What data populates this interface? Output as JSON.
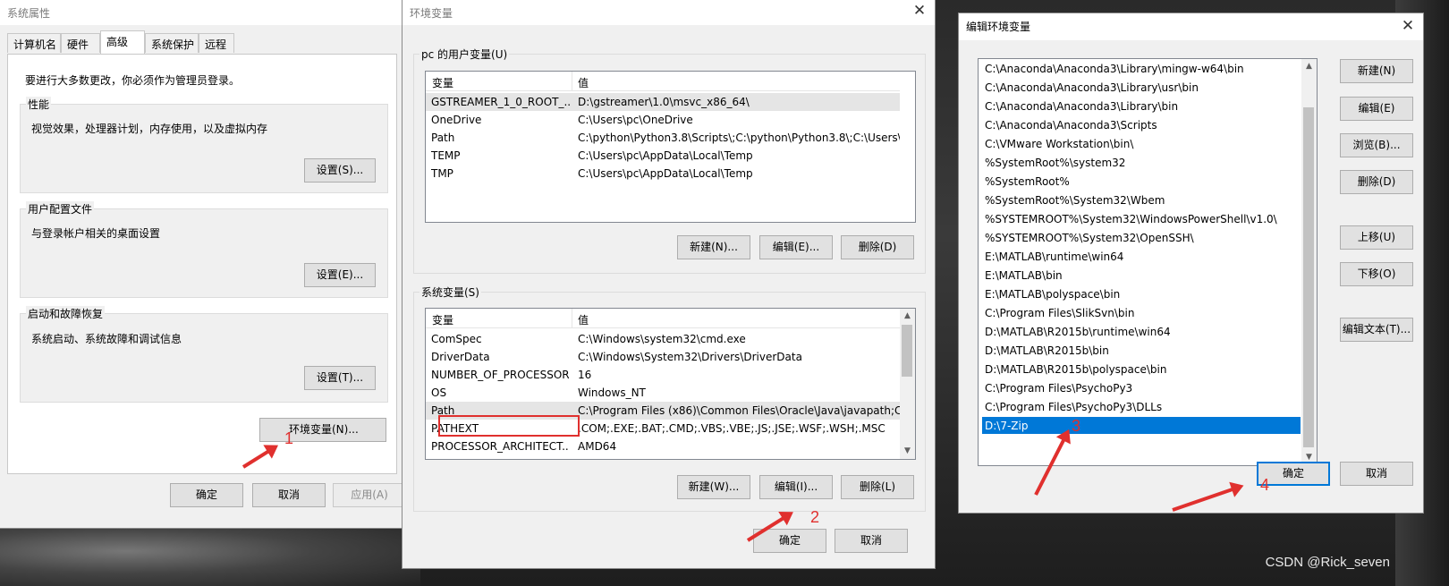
{
  "sysprops": {
    "title": "系统属性",
    "tabs": [
      "计算机名",
      "硬件",
      "高级",
      "系统保护",
      "远程"
    ],
    "notice": "要进行大多数更改，你必须作为管理员登录。",
    "perf_label": "性能",
    "perf_desc": "视觉效果，处理器计划，内存使用，以及虚拟内存",
    "perf_btn": "设置(S)...",
    "profile_label": "用户配置文件",
    "profile_desc": "与登录帐户相关的桌面设置",
    "profile_btn": "设置(E)...",
    "startup_label": "启动和故障恢复",
    "startup_desc": "系统启动、系统故障和调试信息",
    "startup_btn": "设置(T)...",
    "envvar_btn": "环境变量(N)...",
    "ok": "确定",
    "cancel": "取消",
    "apply": "应用(A)"
  },
  "envvars": {
    "title": "环境变量",
    "user_group": "pc 的用户变量(U)",
    "col_var": "变量",
    "col_val": "值",
    "user_rows": [
      {
        "name": "GSTREAMER_1_0_ROOT_...",
        "value": "D:\\gstreamer\\1.0\\msvc_x86_64\\"
      },
      {
        "name": "OneDrive",
        "value": "C:\\Users\\pc\\OneDrive"
      },
      {
        "name": "Path",
        "value": "C:\\python\\Python3.8\\Scripts\\;C:\\python\\Python3.8\\;C:\\Users\\p..."
      },
      {
        "name": "TEMP",
        "value": "C:\\Users\\pc\\AppData\\Local\\Temp"
      },
      {
        "name": "TMP",
        "value": "C:\\Users\\pc\\AppData\\Local\\Temp"
      }
    ],
    "user_new": "新建(N)...",
    "user_edit": "编辑(E)...",
    "user_delete": "删除(D)",
    "sys_group": "系统变量(S)",
    "sys_rows": [
      {
        "name": "ComSpec",
        "value": "C:\\Windows\\system32\\cmd.exe"
      },
      {
        "name": "DriverData",
        "value": "C:\\Windows\\System32\\Drivers\\DriverData"
      },
      {
        "name": "NUMBER_OF_PROCESSORS",
        "value": "16"
      },
      {
        "name": "OS",
        "value": "Windows_NT"
      },
      {
        "name": "Path",
        "value": "C:\\Program Files (x86)\\Common Files\\Oracle\\Java\\javapath;C:..."
      },
      {
        "name": "PATHEXT",
        "value": ".COM;.EXE;.BAT;.CMD;.VBS;.VBE;.JS;.JSE;.WSF;.WSH;.MSC"
      },
      {
        "name": "PROCESSOR_ARCHITECT...",
        "value": "AMD64"
      }
    ],
    "sys_new": "新建(W)...",
    "sys_edit": "编辑(I)...",
    "sys_delete": "删除(L)",
    "ok": "确定",
    "cancel": "取消"
  },
  "editenv": {
    "title": "编辑环境变量",
    "paths": [
      "C:\\Anaconda\\Anaconda3\\Library\\mingw-w64\\bin",
      "C:\\Anaconda\\Anaconda3\\Library\\usr\\bin",
      "C:\\Anaconda\\Anaconda3\\Library\\bin",
      "C:\\Anaconda\\Anaconda3\\Scripts",
      "C:\\VMware Workstation\\bin\\",
      "%SystemRoot%\\system32",
      "%SystemRoot%",
      "%SystemRoot%\\System32\\Wbem",
      "%SYSTEMROOT%\\System32\\WindowsPowerShell\\v1.0\\",
      "%SYSTEMROOT%\\System32\\OpenSSH\\",
      "E:\\MATLAB\\runtime\\win64",
      "E:\\MATLAB\\bin",
      "E:\\MATLAB\\polyspace\\bin",
      "C:\\Program Files\\SlikSvn\\bin",
      "D:\\MATLAB\\R2015b\\runtime\\win64",
      "D:\\MATLAB\\R2015b\\bin",
      "D:\\MATLAB\\R2015b\\polyspace\\bin",
      "C:\\Program Files\\PsychoPy3",
      "C:\\Program Files\\PsychoPy3\\DLLs",
      "D:\\7-Zip"
    ],
    "new": "新建(N)",
    "edit": "编辑(E)",
    "browse": "浏览(B)...",
    "delete": "删除(D)",
    "move_up": "上移(U)",
    "move_down": "下移(O)",
    "edit_text": "编辑文本(T)...",
    "ok": "确定",
    "cancel": "取消"
  },
  "annotations": {
    "n1": "1",
    "n2": "2",
    "n3": "3",
    "n4": "4",
    "accent": "#e0302e"
  },
  "watermark": "CSDN @Rick_seven"
}
